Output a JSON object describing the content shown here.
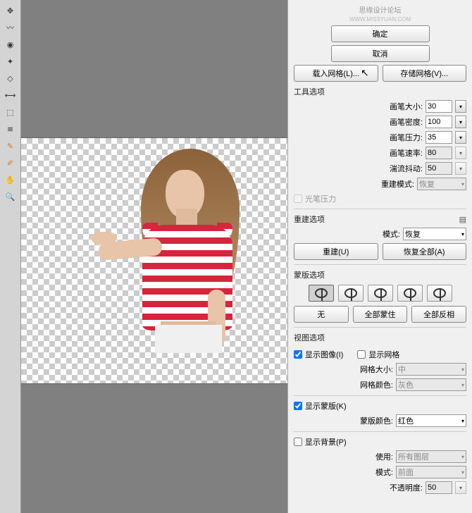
{
  "watermark": {
    "title": "思缘设计论坛",
    "sub": "WWW.MISSYUAN.COM"
  },
  "header": {
    "ok": "确定",
    "cancel": "取消",
    "load_mesh": "载入网格(L)...",
    "save_mesh": "存储网格(V)..."
  },
  "tool_options": {
    "title": "工具选项",
    "brush_size_label": "画笔大小:",
    "brush_size": "30",
    "brush_density_label": "画笔密度:",
    "brush_density": "100",
    "brush_pressure_label": "画笔压力:",
    "brush_pressure": "35",
    "brush_rate_label": "画笔速率:",
    "brush_rate": "80",
    "turbulence_label": "湍流抖动:",
    "turbulence": "50",
    "reconstruct_mode_label": "重建模式:",
    "reconstruct_mode": "恢复",
    "stylus_pressure": "光笔压力"
  },
  "reconstruct": {
    "title": "重建选项",
    "mode_label": "模式:",
    "mode": "恢复",
    "rebuild": "重建(U)",
    "restore_all": "恢复全部(A)"
  },
  "mask": {
    "title": "蒙版选项",
    "none": "无",
    "mask_all": "全部蒙住",
    "invert_all": "全部反相"
  },
  "view": {
    "title": "视图选项",
    "show_image": "显示图像(I)",
    "show_mesh": "显示网格",
    "mesh_size_label": "网格大小:",
    "mesh_size": "中",
    "mesh_color_label": "网格颜色:",
    "mesh_color": "灰色",
    "show_mask": "显示蒙版(K)",
    "mask_color_label": "蒙版颜色:",
    "mask_color": "红色",
    "show_bg": "显示背景(P)",
    "use_label": "使用:",
    "use": "所有图层",
    "mode_label": "模式:",
    "mode": "前面",
    "opacity_label": "不透明度:",
    "opacity": "50"
  },
  "checks": {
    "show_image": true,
    "show_mesh": false,
    "show_mask": true,
    "show_bg": false,
    "stylus": false
  }
}
